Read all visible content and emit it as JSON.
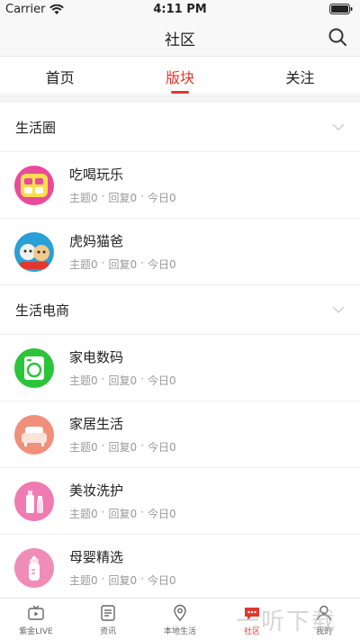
{
  "status": {
    "carrier": "Carrier",
    "time": "4:11 PM"
  },
  "nav": {
    "title": "社区"
  },
  "tabs": [
    {
      "label": "首页",
      "active": false
    },
    {
      "label": "版块",
      "active": true
    },
    {
      "label": "关注",
      "active": false
    }
  ],
  "sections": [
    {
      "title": "生活圈",
      "forums": [
        {
          "name": "吃喝玩乐",
          "icon": "food-fun-icon",
          "color": "#e94b9a",
          "topics": "主题0",
          "replies": "回复0",
          "today": "今日0"
        },
        {
          "name": "虎妈猫爸",
          "icon": "tiger-cat-icon",
          "color": "#2a9fd8",
          "topics": "主题0",
          "replies": "回复0",
          "today": "今日0"
        }
      ]
    },
    {
      "title": "生活电商",
      "forums": [
        {
          "name": "家电数码",
          "icon": "washing-machine-icon",
          "color": "#2bc43b",
          "topics": "主题0",
          "replies": "回复0",
          "today": "今日0"
        },
        {
          "name": "家居生活",
          "icon": "sofa-icon",
          "color": "#f0907a",
          "topics": "主题0",
          "replies": "回复0",
          "today": "今日0"
        },
        {
          "name": "美妆洗护",
          "icon": "cosmetics-icon",
          "color": "#f07ab2",
          "topics": "主题0",
          "replies": "回复0",
          "today": "今日0"
        },
        {
          "name": "母婴精选",
          "icon": "baby-bottle-icon",
          "color": "#f08cb8",
          "topics": "主题0",
          "replies": "回复0",
          "today": "今日0"
        }
      ]
    }
  ],
  "bottom_tabs": [
    {
      "label": "紫金LIVE",
      "icon": "tv-icon"
    },
    {
      "label": "资讯",
      "icon": "news-icon"
    },
    {
      "label": "本地生活",
      "icon": "location-pin-icon"
    },
    {
      "label": "社区",
      "icon": "community-chat-icon"
    },
    {
      "label": "我的",
      "icon": "profile-icon"
    }
  ],
  "watermark": "一听下载",
  "colors": {
    "accent": "#e2372d",
    "muted": "#999999"
  }
}
